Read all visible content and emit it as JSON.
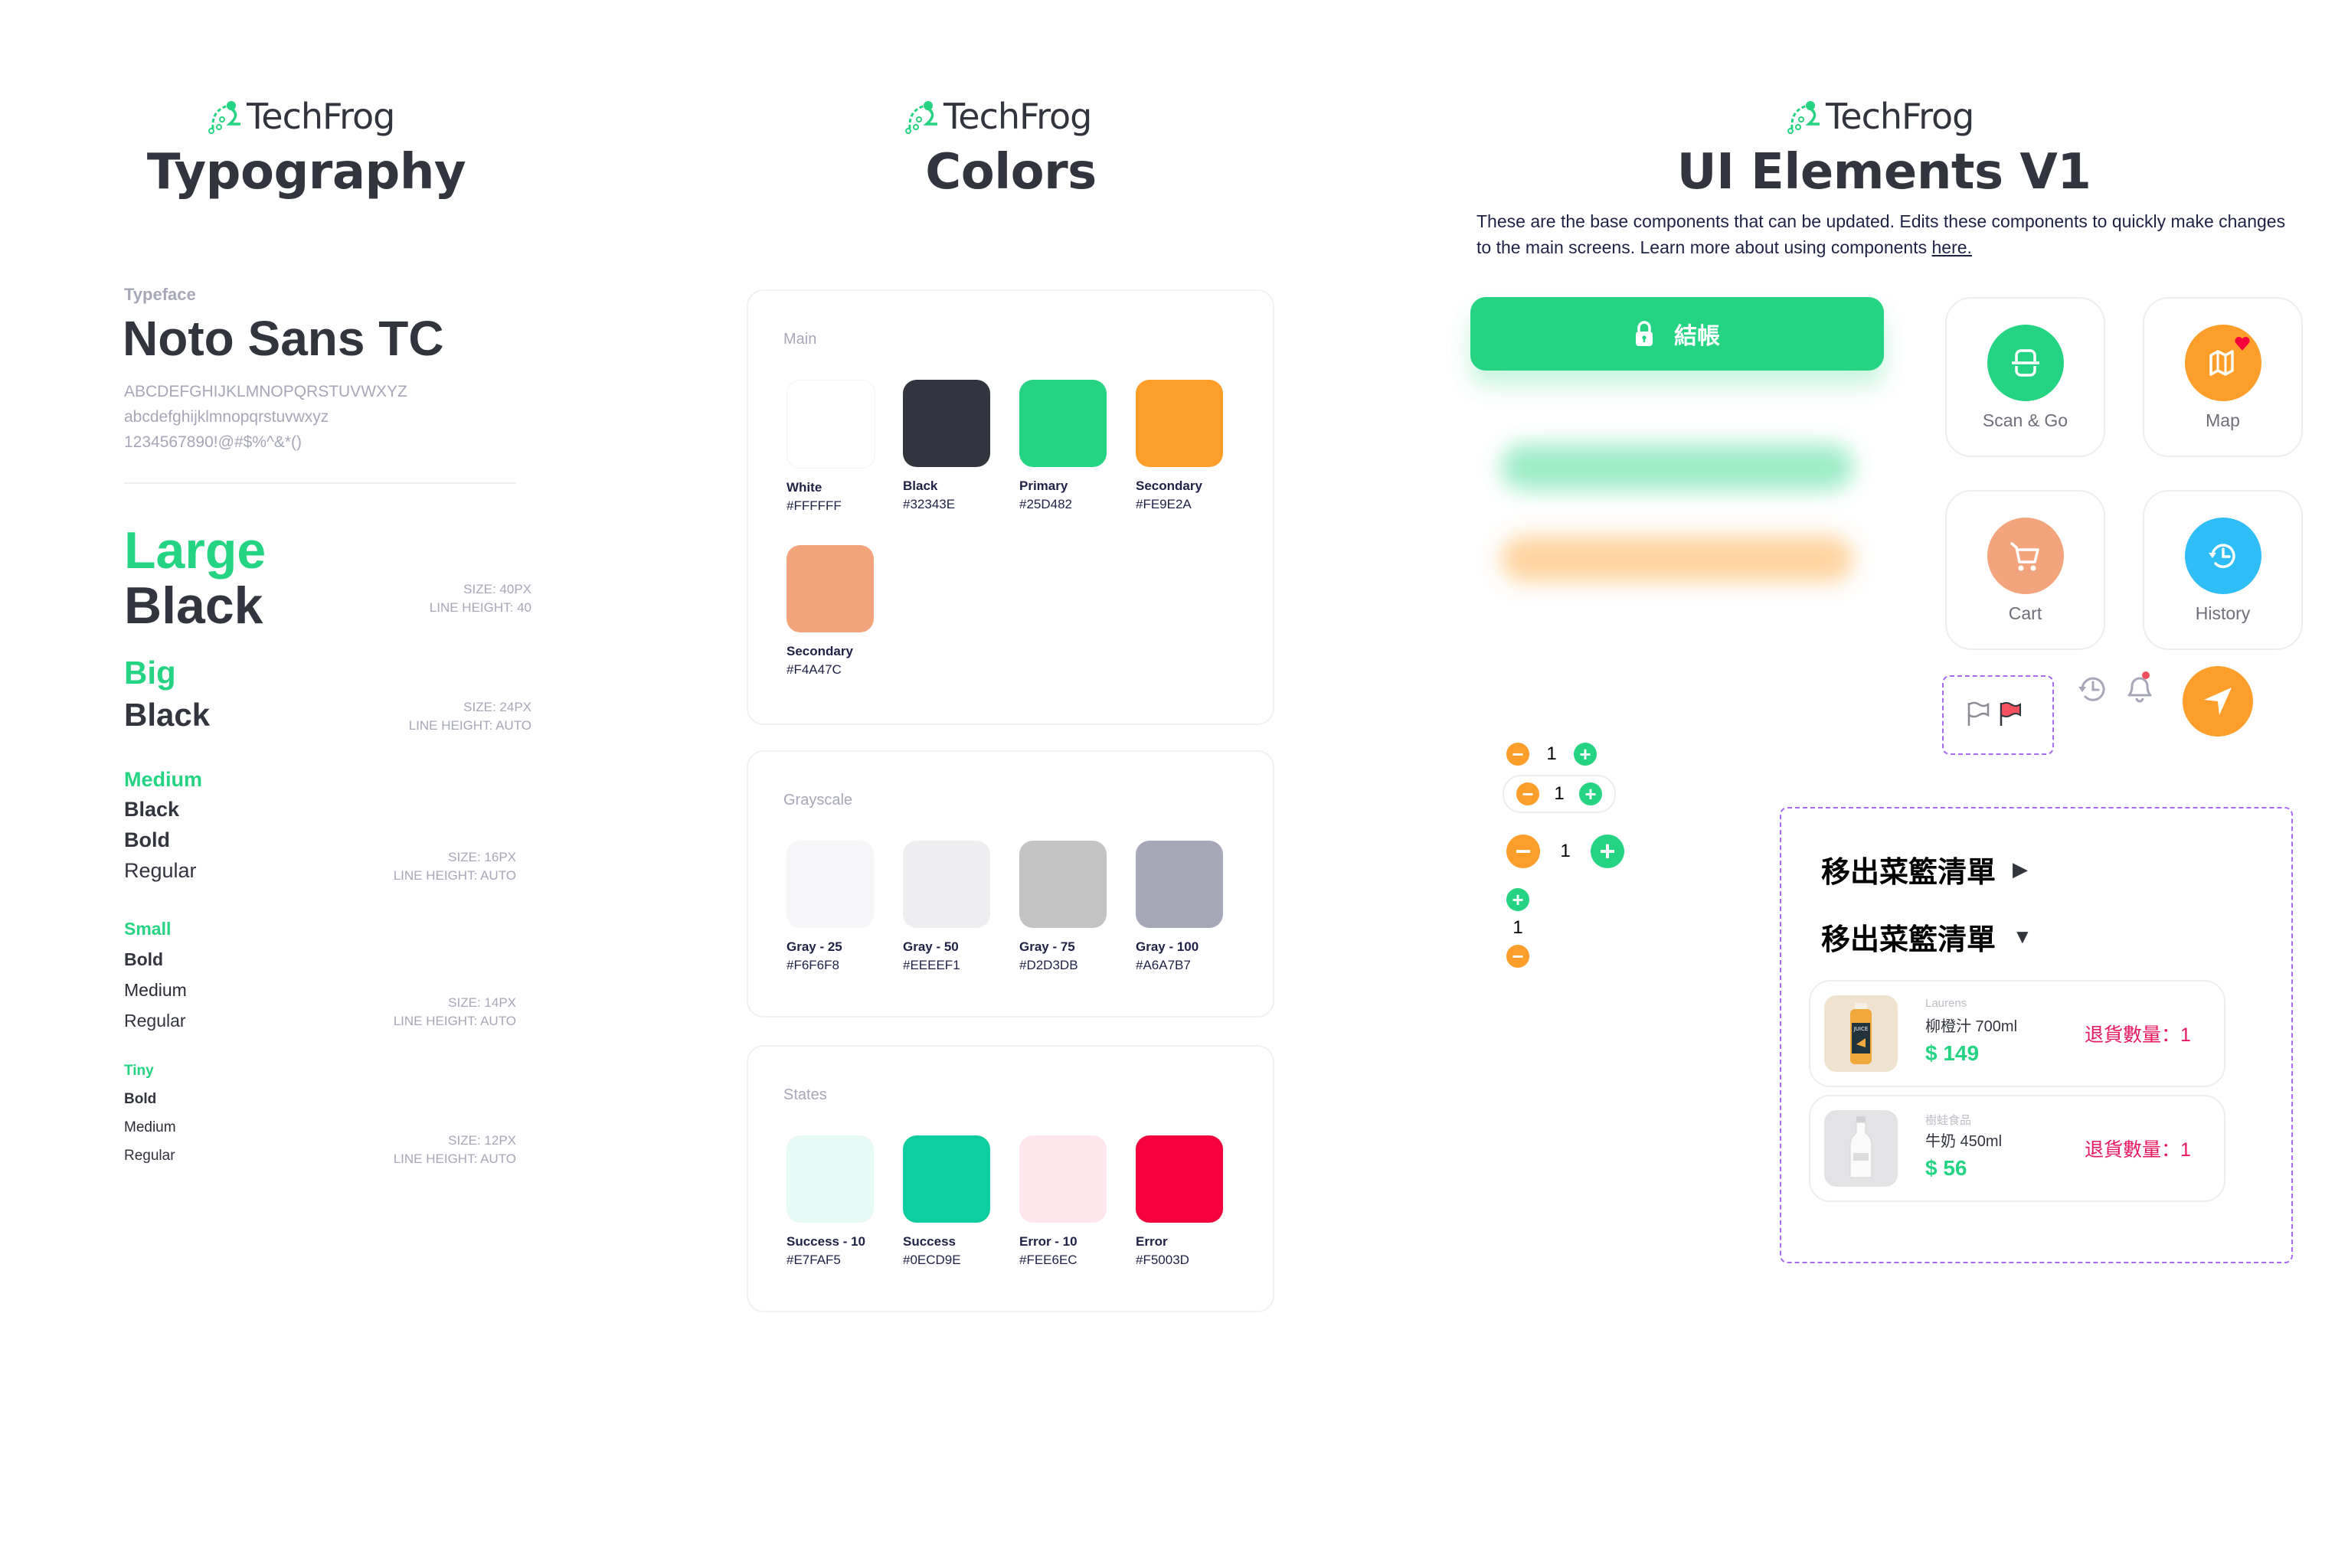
{
  "brand": {
    "name": "TechFrog",
    "primary": "#25D482",
    "dark": "#32343E"
  },
  "typography": {
    "title": "Typography",
    "typeface_label": "Typeface",
    "typeface_name": "Noto Sans TC",
    "samples": [
      "ABCDEFGHIJKLMNOPQRSTUVWXYZ",
      "abcdefghijklmnopqrstuvwxyz",
      "1234567890!@#$%^&*()"
    ],
    "scales": [
      {
        "name": "Large",
        "weights": [
          "Black"
        ],
        "size": "SIZE: 40PX",
        "line_height": "LINE HEIGHT: 40"
      },
      {
        "name": "Big",
        "weights": [
          "Black"
        ],
        "size": "SIZE: 24PX",
        "line_height": "LINE HEIGHT: AUTO"
      },
      {
        "name": "Medium",
        "weights": [
          "Black",
          "Bold",
          "Regular"
        ],
        "size": "SIZE: 16PX",
        "line_height": "LINE HEIGHT: AUTO"
      },
      {
        "name": "Small",
        "weights": [
          "Bold",
          "Medium",
          "Regular"
        ],
        "size": "SIZE: 14PX",
        "line_height": "LINE HEIGHT: AUTO"
      },
      {
        "name": "Tiny",
        "weights": [
          "Bold",
          "Medium",
          "Regular"
        ],
        "size": "SIZE: 12PX",
        "line_height": "LINE HEIGHT: AUTO"
      }
    ]
  },
  "colors": {
    "title": "Colors",
    "groups": [
      {
        "label": "Main",
        "swatches": [
          {
            "name": "White",
            "hex": "#FFFFFF"
          },
          {
            "name": "Black",
            "hex": "#32343E"
          },
          {
            "name": "Primary",
            "hex": "#25D482"
          },
          {
            "name": "Secondary",
            "hex": "#FE9E2A"
          },
          {
            "name": "Secondary",
            "hex": "#F4A47C"
          }
        ]
      },
      {
        "label": "Grayscale",
        "swatches": [
          {
            "name": "Gray - 25",
            "hex": "#F6F6F8"
          },
          {
            "name": "Gray - 50",
            "hex": "#EEEEF1"
          },
          {
            "name": "Gray - 75",
            "hex": "#D2D3DB"
          },
          {
            "name": "Gray - 100",
            "hex": "#A6A7B7"
          }
        ]
      },
      {
        "label": "States",
        "swatches": [
          {
            "name": "Success - 10",
            "hex": "#E7FAF5"
          },
          {
            "name": "Success",
            "hex": "#0ECD9E"
          },
          {
            "name": "Error - 10",
            "hex": "#FEE6EC"
          },
          {
            "name": "Error",
            "hex": "#F5003D"
          }
        ]
      }
    ]
  },
  "ui": {
    "title": "UI Elements V1",
    "description": "These are the base components that can be updated. Edits these components to quickly make changes to the main screens. Learn more about using components ",
    "description_link": "here.",
    "checkout_button": {
      "label": "結帳",
      "icon": "lock-icon"
    },
    "tiles": [
      {
        "label": "Scan & Go",
        "icon": "scan-icon",
        "color": "#25D482"
      },
      {
        "label": "Map",
        "icon": "map-icon",
        "color": "#FE9E2A",
        "badge": "heart-icon"
      },
      {
        "label": "Cart",
        "icon": "cart-icon",
        "color": "#F4A47C"
      },
      {
        "label": "History",
        "icon": "history-icon",
        "color": "#2EBEF5"
      }
    ],
    "flags": [
      "flag-outline-icon",
      "flag-filled-icon"
    ],
    "small_icons": [
      "history-icon",
      "bell-icon",
      "navigation-icon"
    ],
    "steppers": [
      {
        "value": "1",
        "variant": "small"
      },
      {
        "value": "1",
        "variant": "pill"
      },
      {
        "value": "1",
        "variant": "large"
      },
      {
        "value": "1",
        "variant": "vertical"
      }
    ],
    "basket": {
      "title_collapsed": "移出菜籃清單",
      "title_expanded": "移出菜籃清單",
      "collapsed_icon": "▶",
      "expanded_icon": "▼",
      "items": [
        {
          "brand": "Laurens",
          "name": "柳橙汁 700ml",
          "price": "$ 149",
          "return_qty": "退貨數量：1"
        },
        {
          "brand": "樹蛙食品",
          "name": "牛奶 450ml",
          "price": "$ 56",
          "return_qty": "退貨數量：1"
        }
      ]
    }
  }
}
